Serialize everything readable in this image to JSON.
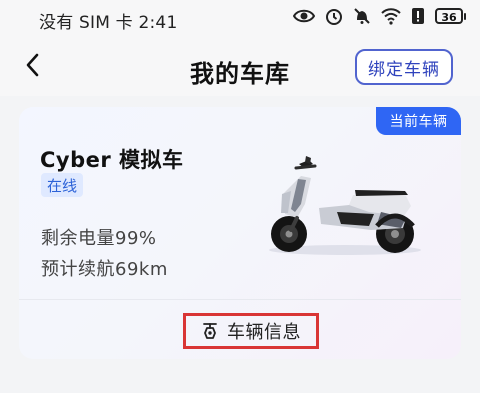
{
  "status_bar": {
    "left_text": "没有 SIM 卡 2:41",
    "battery_level": "36"
  },
  "header": {
    "title": "我的车库",
    "bind_button_label": "绑定车辆"
  },
  "card": {
    "current_tag": "当前车辆",
    "vehicle_name": "Cyber 模拟车",
    "online_badge": "在线",
    "battery_text": "剩余电量99%",
    "range_text": "预计续航69km",
    "vehicle_info_label": "车辆信息"
  },
  "colors": {
    "accent_blue": "#2f66f4",
    "button_blue": "#5164cf",
    "highlight_red": "#d93535"
  }
}
